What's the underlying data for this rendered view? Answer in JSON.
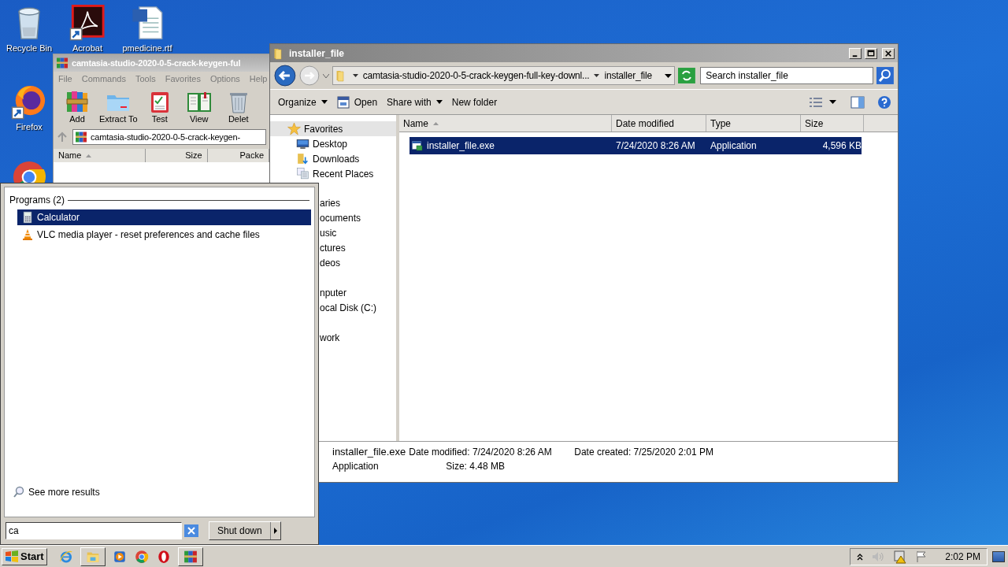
{
  "desktop_icons": [
    {
      "label": "Recycle Bin",
      "kind": "recycle"
    },
    {
      "label": "Acrobat",
      "kind": "acrobat"
    },
    {
      "label": "pmedicine.rtf",
      "kind": "word"
    },
    {
      "label": "Firefox",
      "kind": "firefox"
    },
    {
      "kind": "chrome"
    }
  ],
  "winrar": {
    "title": "camtasia-studio-2020-0-5-crack-keygen-ful",
    "menu": [
      "File",
      "Commands",
      "Tools",
      "Favorites",
      "Options",
      "Help"
    ],
    "toolbar": [
      {
        "label": "Add",
        "kind": "add"
      },
      {
        "label": "Extract To",
        "kind": "extract"
      },
      {
        "label": "Test",
        "kind": "test"
      },
      {
        "label": "View",
        "kind": "view"
      },
      {
        "label": "Delet",
        "kind": "delete"
      }
    ],
    "path": "camtasia-studio-2020-0-5-crack-keygen-",
    "columns": [
      {
        "label": "Name",
        "sorted": true
      },
      {
        "label": "Size",
        "sorted": false
      },
      {
        "label": "Packe",
        "sorted": false
      }
    ]
  },
  "explorer": {
    "title": "installer_file",
    "breadcrumb": [
      "camtasia-studio-2020-0-5-crack-keygen-full-key-downl...",
      "installer_file"
    ],
    "search": {
      "placeholder": "Search installer_file"
    },
    "toolbar": [
      {
        "label": "Organize",
        "kind": "menu"
      },
      {
        "label": "Open",
        "kind": "open"
      },
      {
        "label": "Share with",
        "kind": "menu"
      },
      {
        "label": "New folder",
        "kind": "plain"
      }
    ],
    "nav": [
      {
        "label": "Favorites",
        "kind": "favorites"
      },
      {
        "label": "Desktop",
        "kind": "desktop"
      },
      {
        "label": "Downloads",
        "kind": "downloads"
      },
      {
        "label": "Recent Places",
        "kind": "recent"
      },
      {
        "label": "aries",
        "kind": "header"
      },
      {
        "label": "ocuments",
        "kind": "item"
      },
      {
        "label": "usic",
        "kind": "item"
      },
      {
        "label": "ctures",
        "kind": "item"
      },
      {
        "label": "deos",
        "kind": "item"
      },
      {
        "label": "nputer",
        "kind": "header"
      },
      {
        "label": "ocal Disk (C:)",
        "kind": "item"
      },
      {
        "label": "work",
        "kind": "header"
      }
    ],
    "columns": [
      {
        "label": "Name",
        "sorted": true
      },
      {
        "label": "Date modified",
        "sorted": false
      },
      {
        "label": "Type",
        "sorted": false
      },
      {
        "label": "Size",
        "sorted": false
      }
    ],
    "files": [
      {
        "name": "installer_file.exe",
        "date": "7/24/2020 8:26 AM",
        "type": "Application",
        "size": "4,596 KB",
        "selected": true
      }
    ],
    "details": {
      "name": "installer_file.exe",
      "type": "Application",
      "modified": "Date modified: 7/24/2020 8:26 AM",
      "size": "Size: 4.48 MB",
      "created": "Date created: 7/25/2020 2:01 PM"
    }
  },
  "start_menu": {
    "group": "Programs (2)",
    "results": [
      {
        "label": "Calculator",
        "kind": "calculator",
        "selected": true
      },
      {
        "label": "VLC media player - reset preferences and cache files",
        "kind": "vlc",
        "selected": false
      }
    ],
    "more": "See more results",
    "search": {
      "value": "ca"
    },
    "shutdown": "Shut down"
  },
  "taskbar": {
    "start": "Start",
    "apps": [
      {
        "kind": "ie",
        "open": false
      },
      {
        "kind": "explorer",
        "open": true
      },
      {
        "kind": "media",
        "open": false
      },
      {
        "kind": "chrome",
        "open": false
      },
      {
        "kind": "opera",
        "open": false
      },
      {
        "kind": "winrar",
        "open": true
      }
    ],
    "clock": "2:02 PM"
  }
}
